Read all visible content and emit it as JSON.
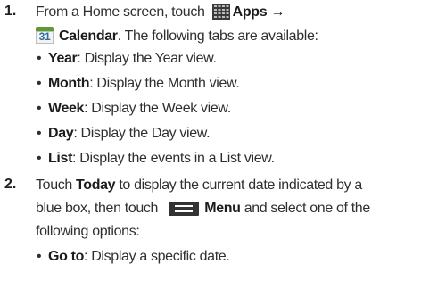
{
  "step1": {
    "number": "1.",
    "intro_prefix": "From a Home screen, touch ",
    "apps_label": "Apps →",
    "calendar_label": "Calendar",
    "intro_suffix": ". The following tabs are available:",
    "calendar_icon_text": "31",
    "tabs": [
      {
        "name": "Year",
        "desc": ": Display the Year view."
      },
      {
        "name": "Month",
        "desc": ": Display the Month view."
      },
      {
        "name": "Week",
        "desc": ": Display the Week view."
      },
      {
        "name": "Day",
        "desc": ": Display the Day view."
      },
      {
        "name": "List",
        "desc": ": Display the events in a List view."
      }
    ]
  },
  "step2": {
    "number": "2.",
    "line1_prefix": "Touch ",
    "today_label": "Today",
    "line1_suffix": " to display the current date indicated by a",
    "line2_prefix": "blue box, then touch ",
    "menu_label": "Menu",
    "line2_suffix": " and select one of the",
    "line3": "following options:",
    "options": [
      {
        "name": "Go to",
        "desc": ": Display a specific date."
      }
    ]
  },
  "bullet": "•"
}
